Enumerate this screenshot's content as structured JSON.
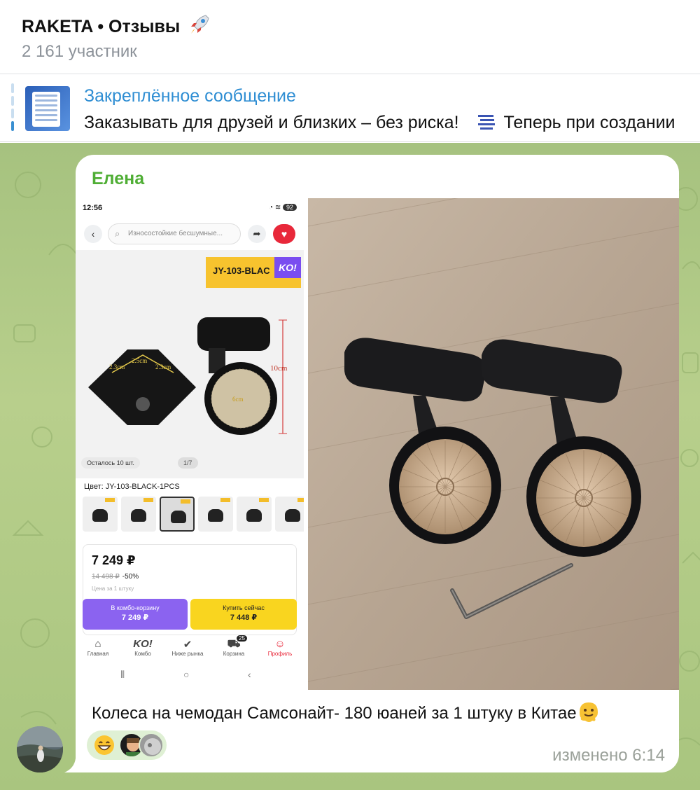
{
  "header": {
    "title": "RAKETA • Отзывы",
    "title_emoji": "rocket-icon",
    "members": "2 161 участник"
  },
  "pinned": {
    "title": "Закреплённое сообщение",
    "text_a": "Заказывать для друзей и близких – без риска!",
    "text_b": "Теперь при создании",
    "emoji": "memo-lines-icon"
  },
  "message": {
    "sender": "Елена",
    "caption": "Колеса на чемодан Самсонайт- 180 юаней за 1 штуку в Китае",
    "caption_emoji": "melting-face-icon",
    "reaction_emoji": "grinning-face-icon",
    "time": "изменено 6:14"
  },
  "screenshot": {
    "status_time": "12:56",
    "status_battery": "92",
    "search_placeholder": "Износостойкие бесшумные...",
    "tag_text": "JY-103-BLAC",
    "tag_ko": "KO!",
    "dim_width_a": "2.3cm",
    "dim_width_b": "2.5cm",
    "dim_width_c": "2.3cm",
    "dim_height": "10cm",
    "dim_wheel": "6cm",
    "stock": "Осталось 10 шт.",
    "counter": "1/7",
    "color": "Цвет: JY-103-BLACK-1PCS",
    "price": "7 249 ₽",
    "old_price": "14 498 ₽",
    "discount": "-50%",
    "unit": "Цена за 1 штуку",
    "combo_label": "В комбо-корзину",
    "combo_price": "7 249 ₽",
    "buy_label": "Купить сейчас",
    "buy_price": "7 448 ₽",
    "nav": [
      "Главная",
      "Комбо",
      "Ниже рынка",
      "Корзина",
      "Профиль"
    ],
    "cart_badge": "25",
    "nav_ko": "KO!"
  }
}
